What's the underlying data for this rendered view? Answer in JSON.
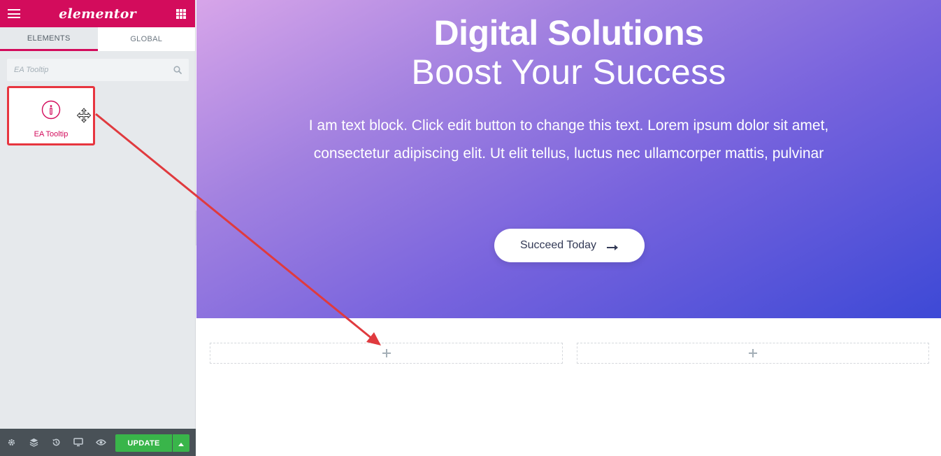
{
  "panel": {
    "brand": "elementor",
    "tabs": [
      {
        "label": "ELEMENTS",
        "active": true
      },
      {
        "label": "GLOBAL",
        "active": false
      }
    ],
    "search": {
      "placeholder": "EA Tooltip",
      "value": ""
    },
    "widgets": [
      {
        "label": "EA Tooltip",
        "icon": "info-circle-icon"
      }
    ],
    "footer": {
      "icons": [
        "settings-icon",
        "layers-icon",
        "history-icon",
        "responsive-icon",
        "preview-icon"
      ],
      "update_label": "UPDATE"
    }
  },
  "hero": {
    "title": "Digital Solutions",
    "subtitle": "Boost Your Success",
    "text": "I am text block. Click edit button to change this text. Lorem ipsum dolor sit amet, consectetur adipiscing elit. Ut elit tellus, luctus nec ullamcorper mattis, pulvinar",
    "cta_label": "Succeed Today"
  },
  "colors": {
    "brand": "#d30c5c",
    "update_green": "#39b54a",
    "highlight_red": "#e7353f",
    "panel_bg": "#e6e9ec",
    "footer_bg": "#495157"
  }
}
